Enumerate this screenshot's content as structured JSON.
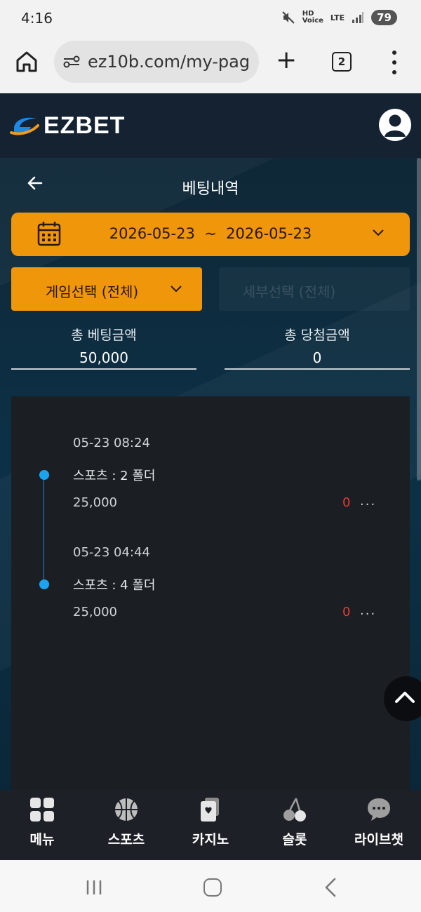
{
  "status": {
    "time": "4:16",
    "network": "LTE",
    "battery": "79"
  },
  "browser": {
    "url": "ez10b.com/my-pag",
    "tab_count": "2"
  },
  "app": {
    "logo_text": "EZBET",
    "page_title": "베팅내역",
    "date_range": "2026-05-23  ~  2026-05-23",
    "game_select": "게임선택 (전체)",
    "detail_select": "세부선택 (전체)",
    "summary": {
      "total_bet_label": "총 베팅금액",
      "total_bet_value": "50,000",
      "total_win_label": "총 당첨금액",
      "total_win_value": "0"
    },
    "bets": [
      {
        "time": "05-23 08:24",
        "type": "스포츠 : 2 폴더",
        "amount": "25,000",
        "result": "0",
        "more": "..."
      },
      {
        "time": "05-23 04:44",
        "type": "스포츠 : 4 폴더",
        "amount": "25,000",
        "result": "0",
        "more": "..."
      }
    ]
  },
  "tabs": [
    {
      "label": "메뉴",
      "icon": "menu-grid-icon"
    },
    {
      "label": "스포츠",
      "icon": "basketball-icon"
    },
    {
      "label": "카지노",
      "icon": "playing-card-icon"
    },
    {
      "label": "슬롯",
      "icon": "cherry-icon"
    },
    {
      "label": "라이브챗",
      "icon": "chat-bubble-icon"
    }
  ],
  "colors": {
    "accent": "#f0960a",
    "timeline": "#1aa4ef",
    "loss": "#e53935",
    "panel": "#1b1e23"
  }
}
